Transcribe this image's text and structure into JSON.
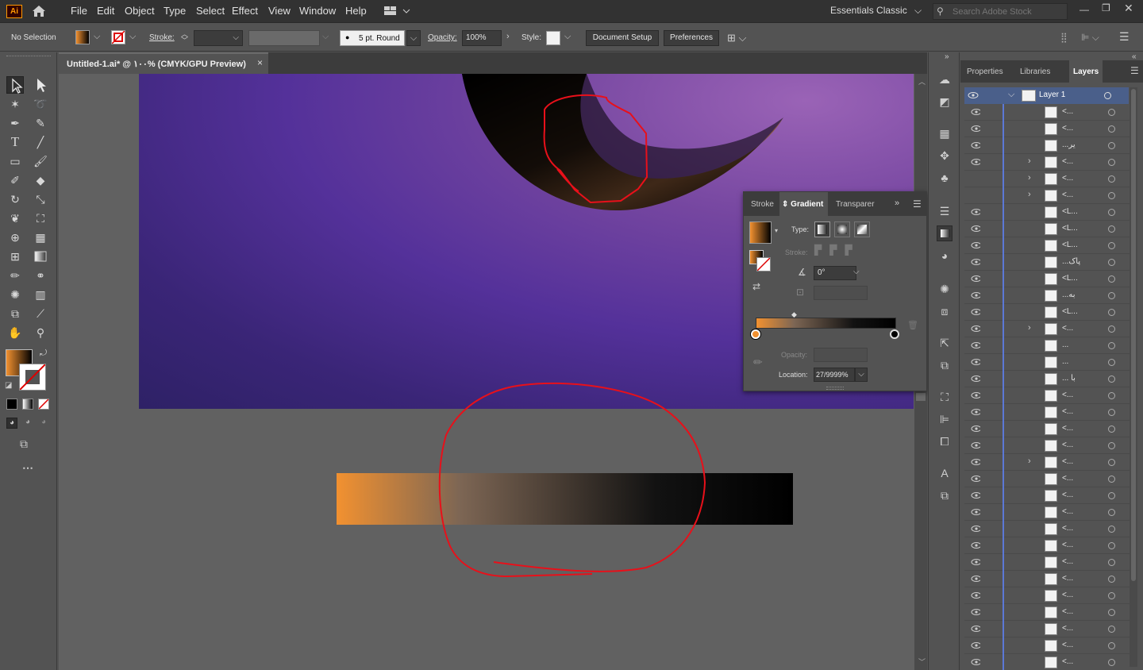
{
  "app": {
    "logo": "Ai",
    "accent": "#ff9a00"
  },
  "menu": [
    "File",
    "Edit",
    "Object",
    "Type",
    "Select",
    "Effect",
    "View",
    "Window",
    "Help"
  ],
  "workspace": "Essentials Classic",
  "search": {
    "placeholder": "Search Adobe Stock"
  },
  "control": {
    "selection": "No Selection",
    "stroke_label": "Stroke:",
    "brush": "5 pt. Round",
    "opacity_label": "Opacity:",
    "opacity": "100%",
    "style_label": "Style:",
    "doc_setup": "Document Setup",
    "preferences": "Preferences"
  },
  "doc_tab": {
    "title": "Untitled-1.ai* @ ١٠٠% (CMYK/GPU Preview)",
    "close": "×"
  },
  "gradient_panel": {
    "tabs": [
      "Stroke",
      "Gradient",
      "Transparer"
    ],
    "type_label": "Type:",
    "stroke_label": "Stroke:",
    "angle": "0°",
    "opacity_label": "Opacity:",
    "location_label": "Location:",
    "location": "27/9999%",
    "start_color": "#f29130",
    "end_color": "#000000"
  },
  "right_tabs": [
    "Properties",
    "Libraries",
    "Layers"
  ],
  "layers": {
    "top": "Layer 1",
    "rows": [
      {
        "name": "<...",
        "eye": true,
        "chev": false
      },
      {
        "name": "<...",
        "eye": true,
        "chev": false
      },
      {
        "name": "...ير",
        "eye": true,
        "chev": false
      },
      {
        "name": "<...",
        "eye": true,
        "chev": true
      },
      {
        "name": "<...",
        "eye": false,
        "chev": true
      },
      {
        "name": "<...",
        "eye": false,
        "chev": true
      },
      {
        "name": "<L...",
        "eye": true,
        "chev": false
      },
      {
        "name": "<L...",
        "eye": true,
        "chev": false
      },
      {
        "name": "<L...",
        "eye": true,
        "chev": false
      },
      {
        "name": "...پاک",
        "eye": true,
        "chev": false
      },
      {
        "name": "<L...",
        "eye": true,
        "chev": false
      },
      {
        "name": "...به",
        "eye": true,
        "chev": false
      },
      {
        "name": "<L...",
        "eye": true,
        "chev": false
      },
      {
        "name": "<...",
        "eye": true,
        "chev": true
      },
      {
        "name": "...",
        "eye": true,
        "chev": false
      },
      {
        "name": "...",
        "eye": true,
        "chev": false
      },
      {
        "name": "... با",
        "eye": true,
        "chev": false
      },
      {
        "name": "<...",
        "eye": true,
        "chev": false
      },
      {
        "name": "<...",
        "eye": true,
        "chev": false
      },
      {
        "name": "<...",
        "eye": true,
        "chev": false
      },
      {
        "name": "<...",
        "eye": true,
        "chev": false
      },
      {
        "name": "<...",
        "eye": true,
        "chev": true
      },
      {
        "name": "<...",
        "eye": true,
        "chev": false
      },
      {
        "name": "<...",
        "eye": true,
        "chev": false
      },
      {
        "name": "<...",
        "eye": true,
        "chev": false
      },
      {
        "name": "<...",
        "eye": true,
        "chev": false
      },
      {
        "name": "<...",
        "eye": true,
        "chev": false
      },
      {
        "name": "<...",
        "eye": true,
        "chev": false
      },
      {
        "name": "<...",
        "eye": true,
        "chev": false
      },
      {
        "name": "<...",
        "eye": true,
        "chev": false
      },
      {
        "name": "<...",
        "eye": true,
        "chev": false
      },
      {
        "name": "<...",
        "eye": true,
        "chev": false
      },
      {
        "name": "<...",
        "eye": true,
        "chev": false
      },
      {
        "name": "<...",
        "eye": true,
        "chev": false
      },
      {
        "name": "<...",
        "eye": true,
        "chev": false
      }
    ]
  }
}
